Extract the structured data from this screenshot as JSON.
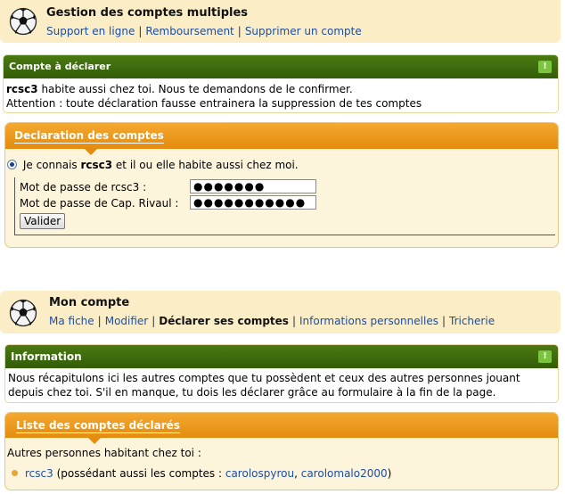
{
  "multi": {
    "title": "Gestion des comptes multiples",
    "links": [
      "Support en ligne",
      "Remboursement",
      "Supprimer un compte"
    ]
  },
  "declare_box": {
    "title": "Compte à déclarer",
    "user": "rcsc3",
    "line1_rest": " habite aussi chez toi. Nous te demandons de le confirmer.",
    "line2": "Attention : toute déclaration fausse entrainera la suppression de tes comptes"
  },
  "declaration": {
    "title": "Declaration des comptes",
    "radio_pre": "Je connais ",
    "radio_user": "rcsc3",
    "radio_post": " et il ou elle habite aussi chez moi.",
    "pw1_label": "Mot de passe de rcsc3 :",
    "pw1_value": "●●●●●●●",
    "pw2_label": "Mot de passe de Cap. Rivaul :",
    "pw2_value": "●●●●●●●●●●●",
    "submit_label": "Valider"
  },
  "account": {
    "title": "Mon compte",
    "links": [
      "Ma fiche",
      "Modifier"
    ],
    "current": "Déclarer ses comptes",
    "links_after": [
      "Informations personnelles",
      "Tricherie"
    ]
  },
  "info_box": {
    "title": "Information",
    "line1": "Nous récapitulons ici les autres comptes que tu possèdent et ceux des autres personnes jouant",
    "line2": "depuis chez toi. S'il en manque, tu dois les déclarer grâce au formulaire à la fin de la page."
  },
  "declared_list": {
    "title": "Liste des comptes déclarés",
    "intro": "Autres personnes habitant chez toi :",
    "entries": [
      {
        "user": "rcsc3",
        "pre": " (possédant aussi les comptes : ",
        "accounts": [
          "carolospyrou",
          "carolomalo2000"
        ],
        "post": ")"
      }
    ]
  },
  "icons": {
    "ball": "soccer-ball-icon",
    "alert": "exclamation-icon",
    "arrow": "pointer-arrow-icon",
    "bullet": "bullet-icon"
  },
  "colors": {
    "header_bg": "#fbeec7",
    "green": "#3d6a0c",
    "orange": "#e9961c",
    "link": "#1b4ea7"
  }
}
